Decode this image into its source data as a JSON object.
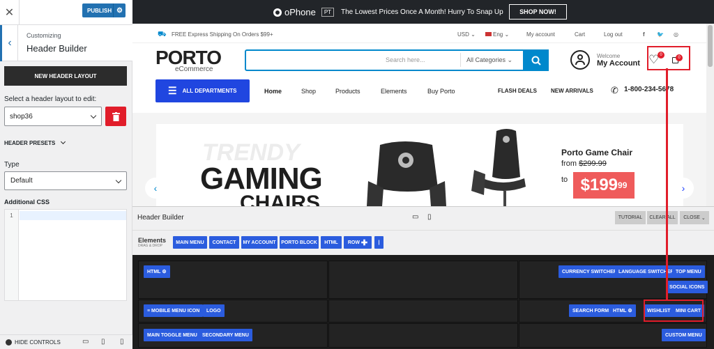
{
  "sidebar": {
    "publish_label": "PUBLISH",
    "customizing_label": "Customizing",
    "section_title": "Header Builder",
    "new_layout_button": "NEW HEADER LAYOUT",
    "select_label": "Select a header layout to edit:",
    "selected_layout": "shop36",
    "presets_label": "HEADER PRESETS",
    "type_label": "Type",
    "type_value": "Default",
    "css_label": "Additional CSS",
    "css_line_number": "1",
    "hide_controls": "HIDE CONTROLS"
  },
  "topbar": {
    "brand": "oPhone",
    "brand_tag": "PT",
    "promo": "The Lowest Prices Once A Month! Hurry To Snap Up",
    "shop_now": "SHOP NOW!"
  },
  "info": {
    "shipping": "FREE Express Shipping On Orders $99+",
    "currency": "USD",
    "language": "Eng",
    "my_account": "My account",
    "cart": "Cart",
    "logout": "Log out"
  },
  "header": {
    "logo": "PORTO",
    "logo_sub": "eCommerce",
    "search_placeholder": "Search here...",
    "search_category": "All Categories",
    "welcome": "Welcome",
    "account": "My Account",
    "wishlist_count": "0",
    "cart_count": "0"
  },
  "nav": {
    "all_departments": "ALL DEPARTMENTS",
    "items": [
      "Home",
      "Shop",
      "Products",
      "Elements",
      "Buy Porto"
    ],
    "flash_deals": "FLASH DEALS",
    "new_arrivals": "NEW ARRIVALS",
    "phone": "1-800-234-5678"
  },
  "banner": {
    "trendy": "TRENDY",
    "headline1": "GAMING",
    "headline2": "CHAIRS",
    "product": "Porto Game Chair",
    "from_label": "from",
    "old_price": "$299.99",
    "to_label": "to",
    "new_price": "$199",
    "new_price_cents": "99"
  },
  "builder": {
    "title": "Header Builder",
    "tutorial": "TUTORIAL",
    "clear_all": "CLEAR ALL",
    "close": "CLOSE",
    "elements_label": "Elements",
    "drag_label": "DRAG & DROP",
    "elements": [
      "MAIN MENU",
      "CONTACT",
      "MY ACCOUNT",
      "PORTO BLOCK",
      "HTML",
      "ROW",
      "|"
    ],
    "row1_left": [
      "HTML"
    ],
    "row1_right": [
      "CURRENCY SWITCHER",
      "LANGUAGE SWITCHER",
      "TOP MENU",
      "SOCIAL ICONS"
    ],
    "row2_left": [
      "MOBILE MENU ICON",
      "LOGO"
    ],
    "row2_right": [
      "SEARCH FORM",
      "HTML",
      "WISHLIST",
      "MINI CART"
    ],
    "row3_left": [
      "MAIN TOGGLE MENU",
      "SECONDARY MENU"
    ],
    "row3_right": [
      "CUSTOM MENU"
    ]
  },
  "colors": {
    "accent": "#0088cc",
    "builder_button": "#2b5cde",
    "highlight": "#e11d2a"
  }
}
